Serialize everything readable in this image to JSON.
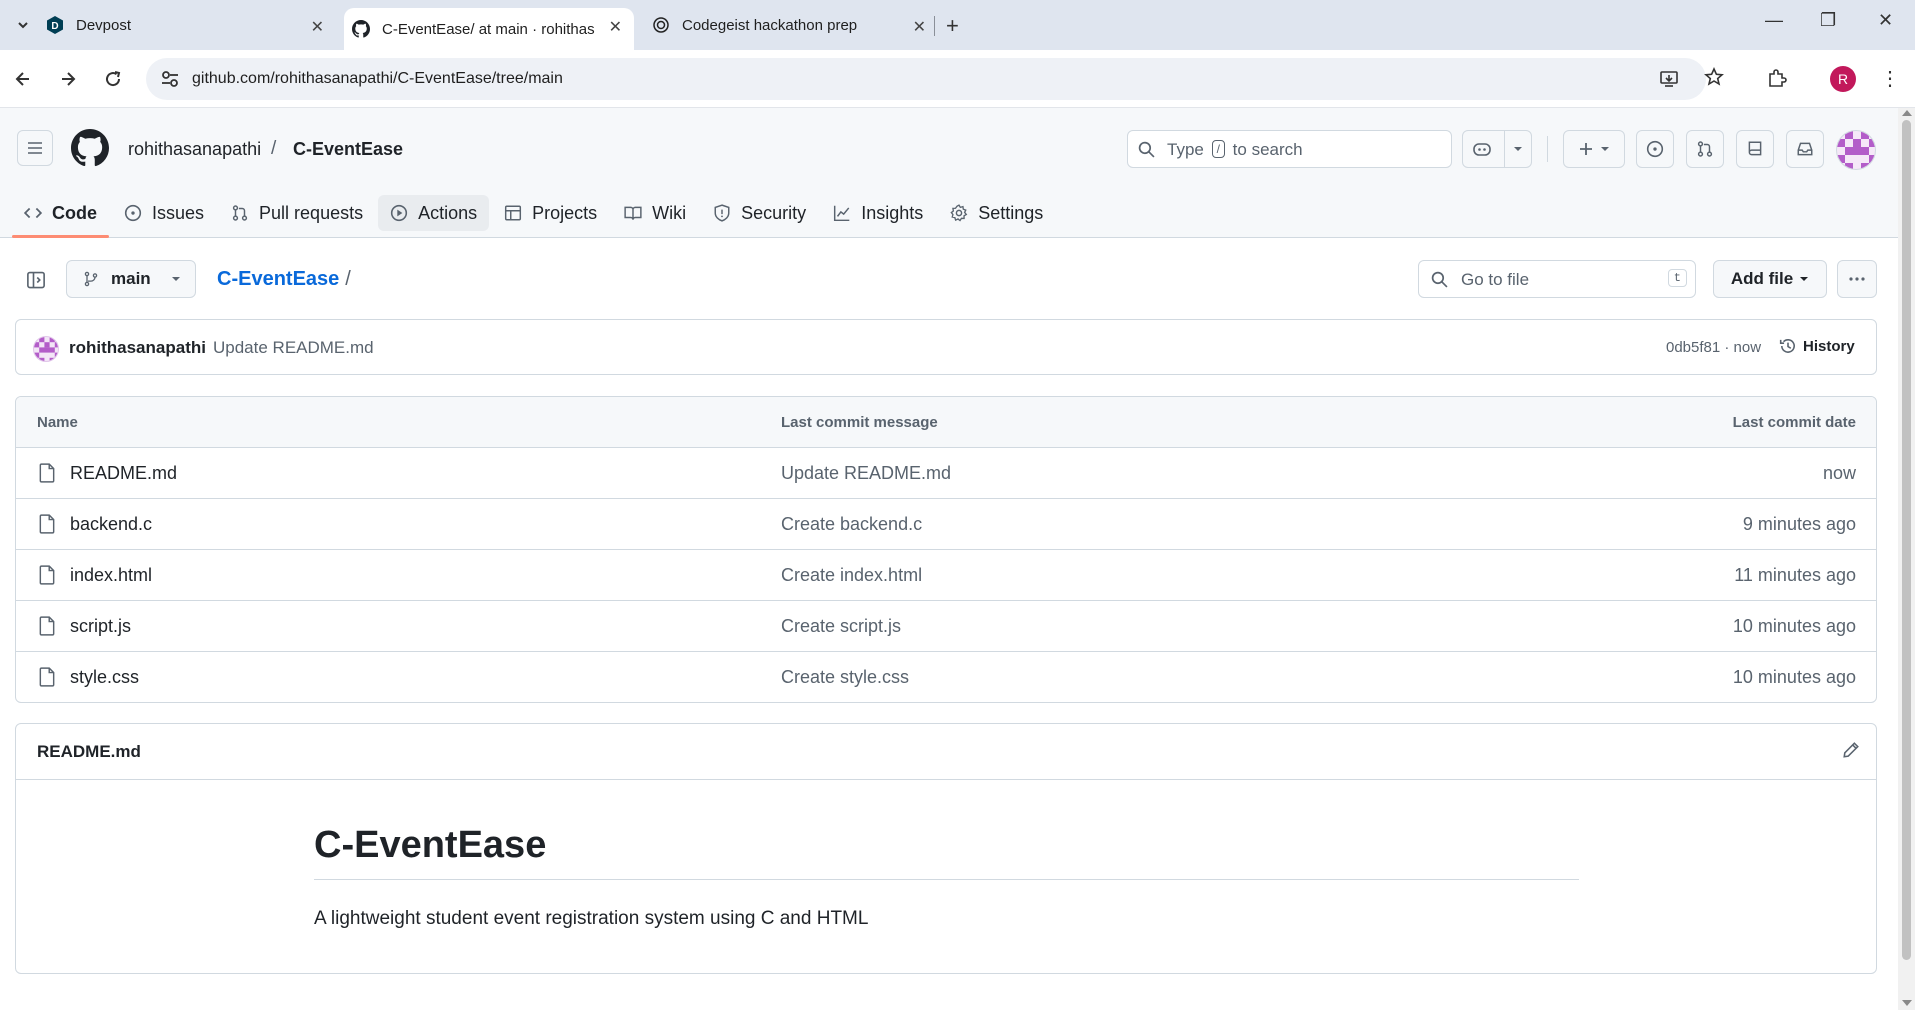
{
  "browser": {
    "tabs": [
      {
        "title": "Devpost",
        "favicon": "devpost-icon",
        "active": false
      },
      {
        "title": "C-EventEase/ at main · rohithas",
        "favicon": "github-icon",
        "active": true
      },
      {
        "title": "Codegeist hackathon prep",
        "favicon": "openai-icon",
        "active": false
      }
    ],
    "url": "github.com/rohithasanapathi/C-EventEase/tree/main",
    "profile_initial": "R",
    "profile_color": "#c2185b"
  },
  "header": {
    "owner": "rohithasanapathi",
    "separator": "/",
    "repo": "C-EventEase",
    "search": {
      "prefix": "Type",
      "key": "/",
      "suffix": "to search"
    }
  },
  "repo_nav": [
    {
      "label": "Code",
      "icon": "code-icon",
      "active": true
    },
    {
      "label": "Issues",
      "icon": "issue-icon"
    },
    {
      "label": "Pull requests",
      "icon": "pull-request-icon"
    },
    {
      "label": "Actions",
      "icon": "play-icon"
    },
    {
      "label": "Projects",
      "icon": "table-icon"
    },
    {
      "label": "Wiki",
      "icon": "book-icon"
    },
    {
      "label": "Security",
      "icon": "shield-icon"
    },
    {
      "label": "Insights",
      "icon": "graph-icon"
    },
    {
      "label": "Settings",
      "icon": "gear-icon"
    }
  ],
  "toolbar": {
    "branch": "main",
    "path_repo": "C-EventEase",
    "path_slash": "/",
    "goto_placeholder": "Go to file",
    "goto_key": "t",
    "add_file": "Add file"
  },
  "latest_commit": {
    "author": "rohithasanapathi",
    "message": "Update README.md",
    "sha_time": "0db5f81 · now",
    "history": "History"
  },
  "file_table": {
    "columns": [
      "Name",
      "Last commit message",
      "Last commit date"
    ],
    "rows": [
      {
        "name": "README.md",
        "message": "Update README.md",
        "date": "now"
      },
      {
        "name": "backend.c",
        "message": "Create backend.c",
        "date": "9 minutes ago"
      },
      {
        "name": "index.html",
        "message": "Create index.html",
        "date": "11 minutes ago"
      },
      {
        "name": "script.js",
        "message": "Create script.js",
        "date": "10 minutes ago"
      },
      {
        "name": "style.css",
        "message": "Create style.css",
        "date": "10 minutes ago"
      }
    ]
  },
  "readme": {
    "filename": "README.md",
    "heading": "C-EventEase",
    "description": "A lightweight student event registration system using C and HTML"
  },
  "colors": {
    "link": "#0969da",
    "active_tab_underline": "#fd8c73",
    "chrome_bg": "#dfe5ef"
  }
}
